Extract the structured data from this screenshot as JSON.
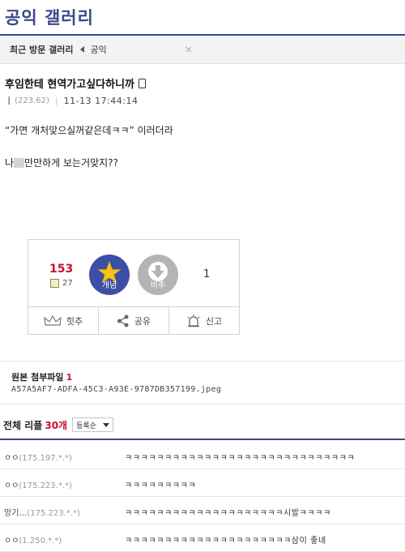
{
  "gallery": {
    "title": "공익 갤러리"
  },
  "recent": {
    "label": "최근 방문 갤러리",
    "item": "공익",
    "close": "×"
  },
  "post": {
    "title": "후임한테 현역가고싶다하니까",
    "nick": "ㅣ",
    "ip": "(223.62)",
    "date": "11-13 17:44:14",
    "body": {
      "line1": "“가면 개처맞으실꺼같은데ㅋㅋ” 이러더라",
      "line2_pre": "나",
      "line2_post": "만만하게 보는거맞지??"
    }
  },
  "vote": {
    "up_count": "153",
    "fix_count": "27",
    "up_label": "개념",
    "down_label": "비추",
    "down_count": "1",
    "actions": {
      "hit": "힛추",
      "share": "공유",
      "report": "신고"
    }
  },
  "attachment": {
    "title": "원본 첨부파일",
    "count": "1",
    "filename": "A57A5AF7-ADFA-45C3-A93E-9787DB357199.jpeg"
  },
  "replies": {
    "label": "전체 리플",
    "count": "30개",
    "sort": "등록순",
    "items": [
      {
        "nick": "ㅇㅇ",
        "ip": "(175.197.*.*)",
        "text": "ㅋㅋㅋㅋㅋㅋㅋㅋㅋㅋㅋㅋㅋㅋㅋㅋㅋㅋㅋㅋㅋㅋㅋㅋㅋㅋㅋㅋㅋ"
      },
      {
        "nick": "ㅇㅇ",
        "ip": "(175.223.*.*)",
        "text": "ㅋㅋㅋㅋㅋㅋㅋㅋㅋ"
      },
      {
        "nick": "앙기…",
        "ip": "(175.223.*.*)",
        "text": "ㅋㅋㅋㅋㅋㅋㅋㅋㅋㅋㅋㅋㅋㅋㅋㅋㅋㅋㅋㅋ시발ㅋㅋㅋㅋ"
      },
      {
        "nick": "ㅇㅇ",
        "ip": "(1.250.*.*)",
        "text": "ㅋㅋㅋㅋㅋㅋㅋㅋㅋㅋㅋㅋㅋㅋㅋㅋㅋㅋㅋㅋㅋ삼이 좋네"
      }
    ]
  },
  "colors": {
    "brand": "#3b4890",
    "accent_red": "#c8102e",
    "up_button": "#3b4fa8",
    "down_button": "#b4b4b4"
  }
}
